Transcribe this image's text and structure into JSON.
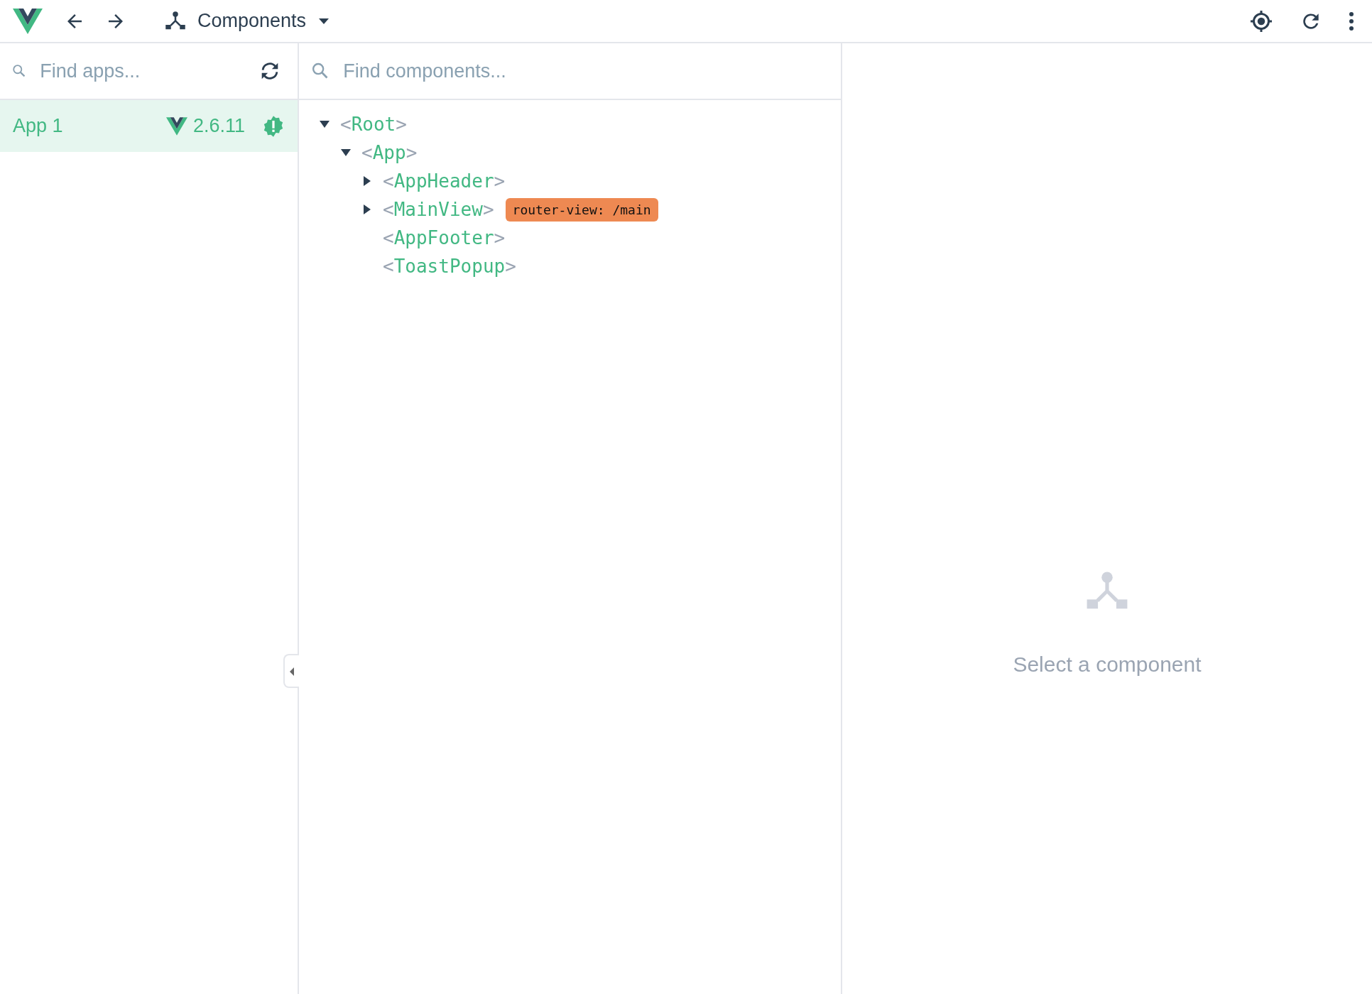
{
  "toolbar": {
    "view_label": "Components"
  },
  "apps_panel": {
    "search": {
      "placeholder": "Find apps..."
    },
    "apps": [
      {
        "name": "App 1",
        "version": "2.6.11",
        "selected": true
      }
    ]
  },
  "tree_panel": {
    "search": {
      "placeholder": "Find components..."
    },
    "tree": [
      {
        "label": "<Root>",
        "kind": "branch",
        "expanded": true,
        "children": [
          {
            "label": "<App>",
            "kind": "branch",
            "expanded": true,
            "children": [
              {
                "label": "<AppHeader>",
                "kind": "branch",
                "expanded": false
              },
              {
                "label": "<MainView>",
                "kind": "branch",
                "expanded": false,
                "badge": "router-view: /main"
              },
              {
                "label": "<AppFooter>",
                "kind": "leaf"
              },
              {
                "label": "<ToastPopup>",
                "kind": "leaf"
              }
            ]
          }
        ]
      }
    ]
  },
  "inspector": {
    "empty_message": "Select a component"
  }
}
